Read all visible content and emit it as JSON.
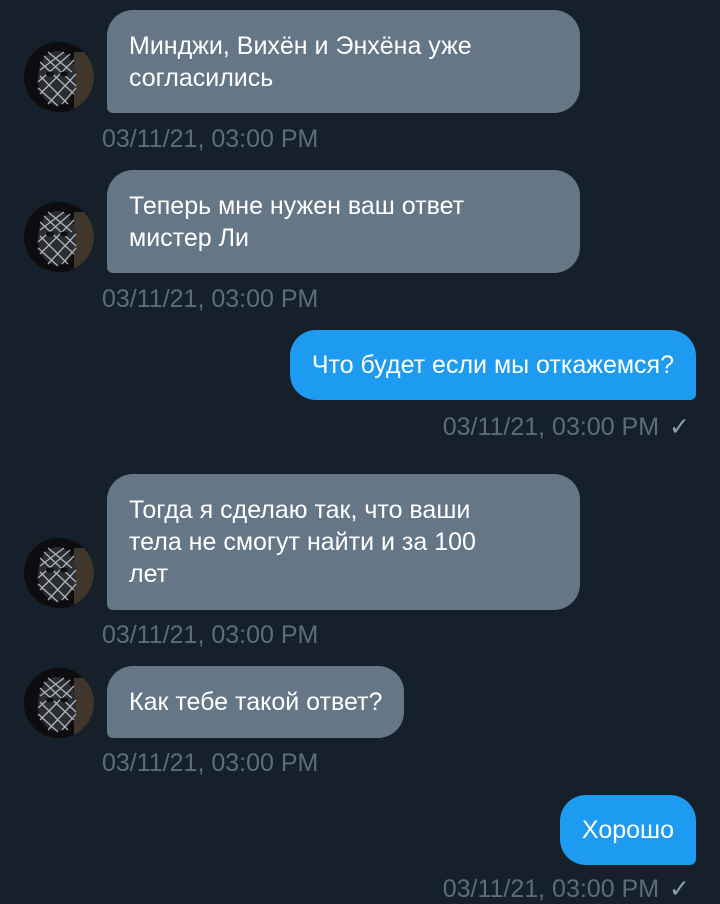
{
  "messages": [
    {
      "direction": "incoming",
      "text": "Минджи, Вихён и Энхёна уже\nсогласились",
      "time": "03/11/21, 03:00 PM"
    },
    {
      "direction": "incoming",
      "text": "Теперь мне нужен ваш ответ\nмистер Ли",
      "time": "03/11/21, 03:00 PM"
    },
    {
      "direction": "outgoing",
      "text": "Что будет если мы откажемся?",
      "time": "03/11/21, 03:00 PM"
    },
    {
      "direction": "incoming",
      "text": "Тогда я сделаю так, что ваши\nтела не смогут найти и за 100\nлет",
      "time": "03/11/21, 03:00 PM"
    },
    {
      "direction": "incoming",
      "text": "Как тебе такой ответ?",
      "time": "03/11/21, 03:00 PM"
    },
    {
      "direction": "outgoing",
      "text": "Хорошо",
      "time": "03/11/21, 03:00 PM"
    }
  ],
  "read_mark": "✓",
  "colors": {
    "background": "#15202b",
    "incoming_bubble": "#657786",
    "outgoing_bubble": "#1d9bf0",
    "timestamp": "#5b6d7c"
  },
  "icons": {
    "avatar": "masked-face-avatar",
    "read_receipt": "checkmark-icon"
  }
}
